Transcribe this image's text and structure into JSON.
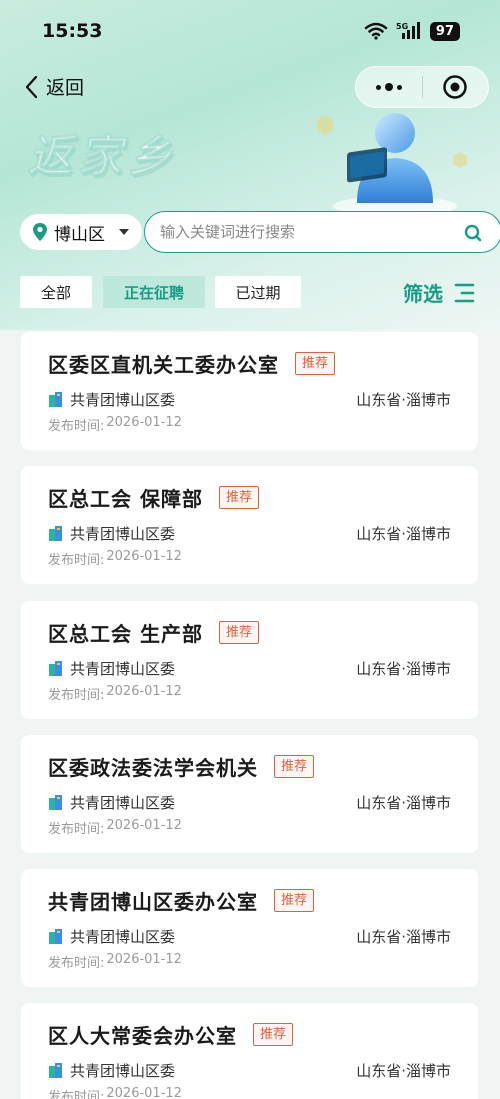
{
  "status": {
    "time": "15:53",
    "network": "5G",
    "battery": "97"
  },
  "nav": {
    "back_label": "返回"
  },
  "banner": {
    "title": "返家乡"
  },
  "search": {
    "district": "博山区",
    "placeholder": "输入关键词进行搜索"
  },
  "filters": {
    "tabs": [
      {
        "label": "全部",
        "active": false
      },
      {
        "label": "正在征聘",
        "active": true
      },
      {
        "label": "已过期",
        "active": false
      }
    ],
    "screen_label": "筛选"
  },
  "colors": {
    "accent": "#1a9b86",
    "badge": "#d8633f",
    "tab_active_bg": "#bfe8dc"
  },
  "listings": [
    {
      "title": "区委区直机关工委办公室",
      "badge": "推荐",
      "org": "共青团博山区委",
      "location": "山东省·淄博市",
      "date_label": "发布时间:",
      "date": "2026-01-12"
    },
    {
      "title": "区总工会 保障部",
      "badge": "推荐",
      "org": "共青团博山区委",
      "location": "山东省·淄博市",
      "date_label": "发布时间:",
      "date": "2026-01-12"
    },
    {
      "title": "区总工会 生产部",
      "badge": "推荐",
      "org": "共青团博山区委",
      "location": "山东省·淄博市",
      "date_label": "发布时间:",
      "date": "2026-01-12"
    },
    {
      "title": "区委政法委法学会机关",
      "badge": "推荐",
      "org": "共青团博山区委",
      "location": "山东省·淄博市",
      "date_label": "发布时间:",
      "date": "2026-01-12"
    },
    {
      "title": "共青团博山区委办公室",
      "badge": "推荐",
      "org": "共青团博山区委",
      "location": "山东省·淄博市",
      "date_label": "发布时间:",
      "date": "2026-01-12"
    },
    {
      "title": "区人大常委会办公室",
      "badge": "推荐",
      "org": "共青团博山区委",
      "location": "山东省·淄博市",
      "date_label": "发布时间:",
      "date": "2026-01-12"
    }
  ]
}
